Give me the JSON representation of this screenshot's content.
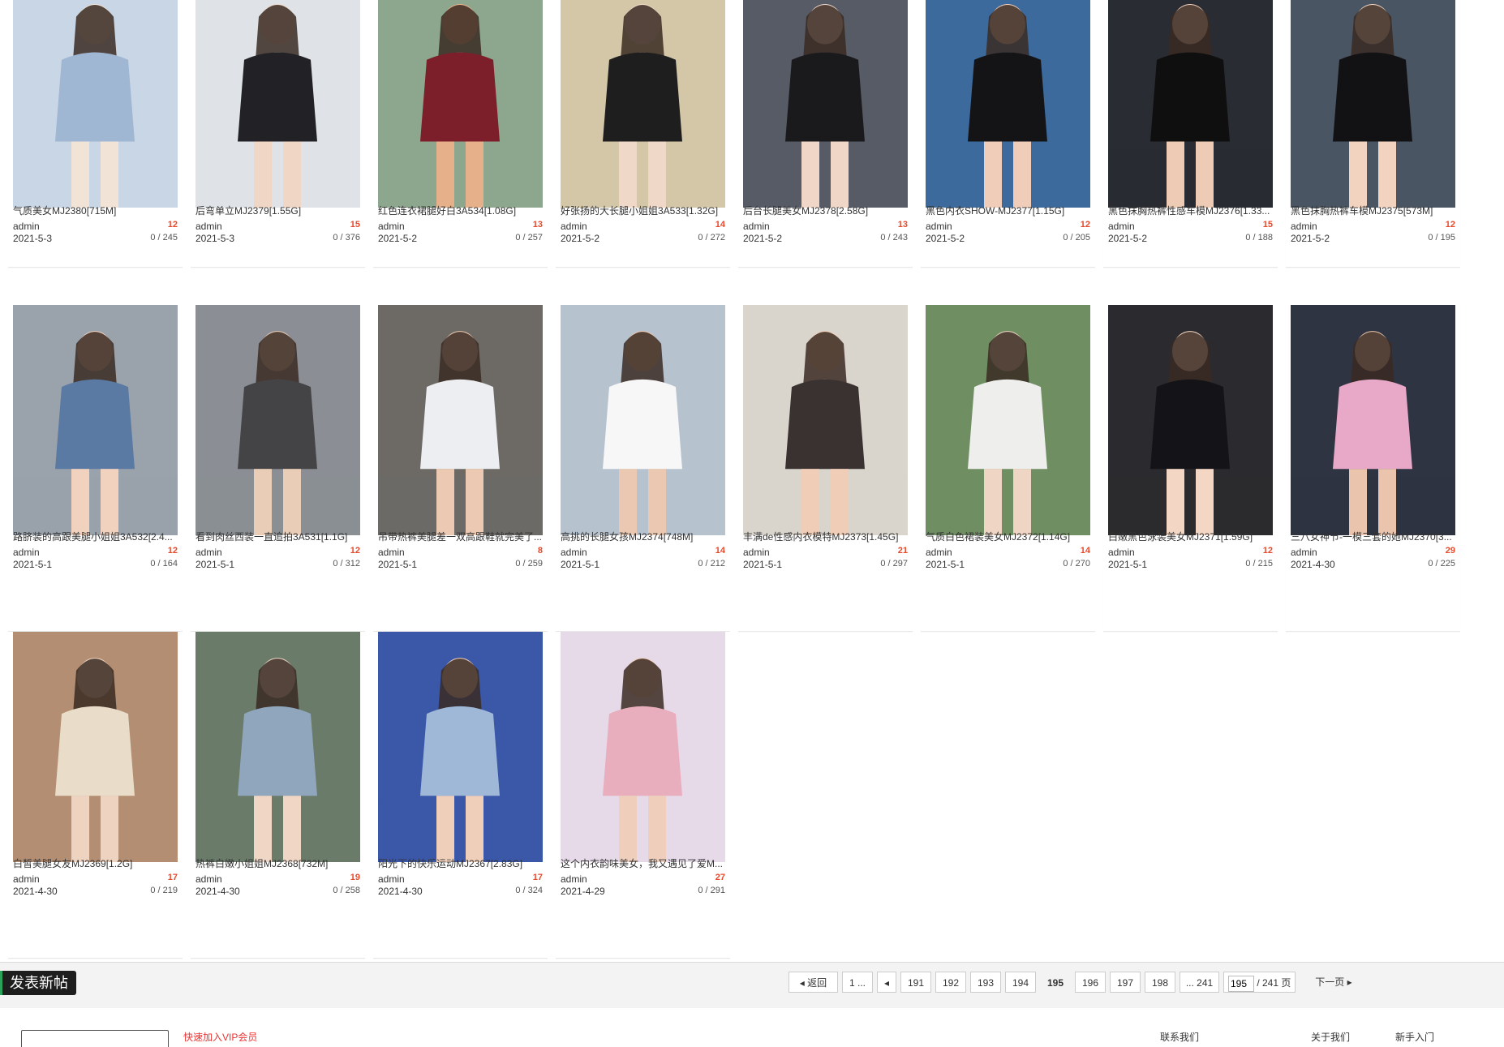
{
  "cards": [
    {
      "title": "气质美女MJ2380[715M]",
      "author": "admin",
      "replies": "12",
      "date": "2021-5-3",
      "views": "0 / 245",
      "palette": [
        "#c9d6e6",
        "#9fb7d3",
        "#f1e3d6"
      ]
    },
    {
      "title": "后弯单立MJ2379[1.55G]",
      "author": "admin",
      "replies": "15",
      "date": "2021-5-3",
      "views": "0 / 376",
      "palette": [
        "#dfe3e8",
        "#222226",
        "#f0d7c5"
      ]
    },
    {
      "title": "红色连衣裙腿好白3A534[1.08G]",
      "author": "admin",
      "replies": "13",
      "date": "2021-5-2",
      "views": "0 / 257",
      "palette": [
        "#8da78e",
        "#7d1f2a",
        "#e6b08a"
      ]
    },
    {
      "title": "好张扬的大长腿小姐姐3A533[1.32G]",
      "author": "admin",
      "replies": "14",
      "date": "2021-5-2",
      "views": "0 / 272",
      "palette": [
        "#d4c7a8",
        "#1e1e1e",
        "#f0d8c8"
      ]
    },
    {
      "title": "后台长腿美女MJ2378[2.58G]",
      "author": "admin",
      "replies": "13",
      "date": "2021-5-2",
      "views": "0 / 243",
      "palette": [
        "#565b66",
        "#1a1a1c",
        "#efd6c7"
      ]
    },
    {
      "title": "黑色内衣SHOW-MJ2377[1.15G]",
      "author": "admin",
      "replies": "12",
      "date": "2021-5-2",
      "views": "0 / 205",
      "palette": [
        "#3c6a9c",
        "#141416",
        "#efcdb9"
      ]
    },
    {
      "title": "黑色抹胸热裤性感车模MJ2376[1.33...",
      "author": "admin",
      "replies": "15",
      "date": "2021-5-2",
      "views": "0 / 188",
      "palette": [
        "#2a2c33",
        "#0f0f10",
        "#eecbb5"
      ]
    },
    {
      "title": "黑色抹胸热裤车模MJ2375[573M]",
      "author": "admin",
      "replies": "12",
      "date": "2021-5-2",
      "views": "0 / 195",
      "palette": [
        "#4a5563",
        "#121214",
        "#f2d3c0"
      ]
    },
    {
      "title": "路脐装的高跟美腿小姐姐3A532[2.4...",
      "author": "admin",
      "replies": "12",
      "date": "2021-5-1",
      "views": "0 / 164",
      "palette": [
        "#9aa2ab",
        "#5b7aa3",
        "#f0d2bf"
      ]
    },
    {
      "title": "看到肉丝西装一直追拍3A531[1.1G]",
      "author": "admin",
      "replies": "12",
      "date": "2021-5-1",
      "views": "0 / 312",
      "palette": [
        "#8b8f95",
        "#444447",
        "#e9cdb7"
      ]
    },
    {
      "title": "吊带热裤美腿差一双高跟鞋就完美了...",
      "author": "admin",
      "replies": "8",
      "date": "2021-5-1",
      "views": "0 / 259",
      "palette": [
        "#6d6a66",
        "#eceef2",
        "#ecc9b2"
      ]
    },
    {
      "title": "高挑的长腿女孩MJ2374[748M]",
      "author": "admin",
      "replies": "14",
      "date": "2021-5-1",
      "views": "0 / 212",
      "palette": [
        "#b7c2cf",
        "#f7f7f7",
        "#eac8b1"
      ]
    },
    {
      "title": "丰满de性感内衣模特MJ2373[1.45G]",
      "author": "admin",
      "replies": "21",
      "date": "2021-5-1",
      "views": "0 / 297",
      "palette": [
        "#d9d4cc",
        "#3a3230",
        "#f0cdb6"
      ]
    },
    {
      "title": "气质白色裙装美女MJ2372[1.14G]",
      "author": "admin",
      "replies": "14",
      "date": "2021-5-1",
      "views": "0 / 270",
      "palette": [
        "#6f8f63",
        "#eeeeec",
        "#efd5c3"
      ]
    },
    {
      "title": "白嫩黑色泳装美女MJ2371[1.59G]",
      "author": "admin",
      "replies": "12",
      "date": "2021-5-1",
      "views": "0 / 215",
      "palette": [
        "#2b2b2f",
        "#141418",
        "#f3d6c4"
      ]
    },
    {
      "title": "三八女神节-一模三套的她MJ2370[3...",
      "author": "admin",
      "replies": "29",
      "date": "2021-4-30",
      "views": "0 / 225",
      "palette": [
        "#2f3442",
        "#e8a8c8",
        "#eac4ad"
      ]
    },
    {
      "title": "白皙美腿女友MJ2369[1.2G]",
      "author": "admin",
      "replies": "17",
      "date": "2021-4-30",
      "views": "0 / 219",
      "palette": [
        "#b38e73",
        "#e9dcc8",
        "#efd3c1"
      ]
    },
    {
      "title": "热裤白嫩小姐姐MJ2368[732M]",
      "author": "admin",
      "replies": "19",
      "date": "2021-4-30",
      "views": "0 / 258",
      "palette": [
        "#6a7b6a",
        "#8fa6bd",
        "#efd6c5"
      ]
    },
    {
      "title": "阳光下的快乐运动MJ2367[2.83G]",
      "author": "admin",
      "replies": "17",
      "date": "2021-4-30",
      "views": "0 / 324",
      "palette": [
        "#3a57a8",
        "#9fb8d8",
        "#efcfba"
      ]
    },
    {
      "title": "这个内衣韵味美女，我又遇见了爱M...",
      "author": "admin",
      "replies": "27",
      "date": "2021-4-29",
      "views": "0 / 291",
      "palette": [
        "#e6d9e8",
        "#e8aebd",
        "#efcfbc"
      ]
    }
  ],
  "toolbar": {
    "new_post_label": "发表新帖"
  },
  "pagination": {
    "back_label": "返回",
    "first_label": "1 ...",
    "pages": [
      "191",
      "192",
      "193",
      "194",
      "195",
      "196",
      "197",
      "198"
    ],
    "current": "195",
    "last_label": "... 241",
    "jump_value": "195",
    "total_label": "/ 241 页",
    "next_label": "下一页"
  },
  "bottom": {
    "red_text": "快速加入VIP会员",
    "link_1": "联系我们",
    "link_2": "关于我们",
    "link_3": "新手入门"
  }
}
